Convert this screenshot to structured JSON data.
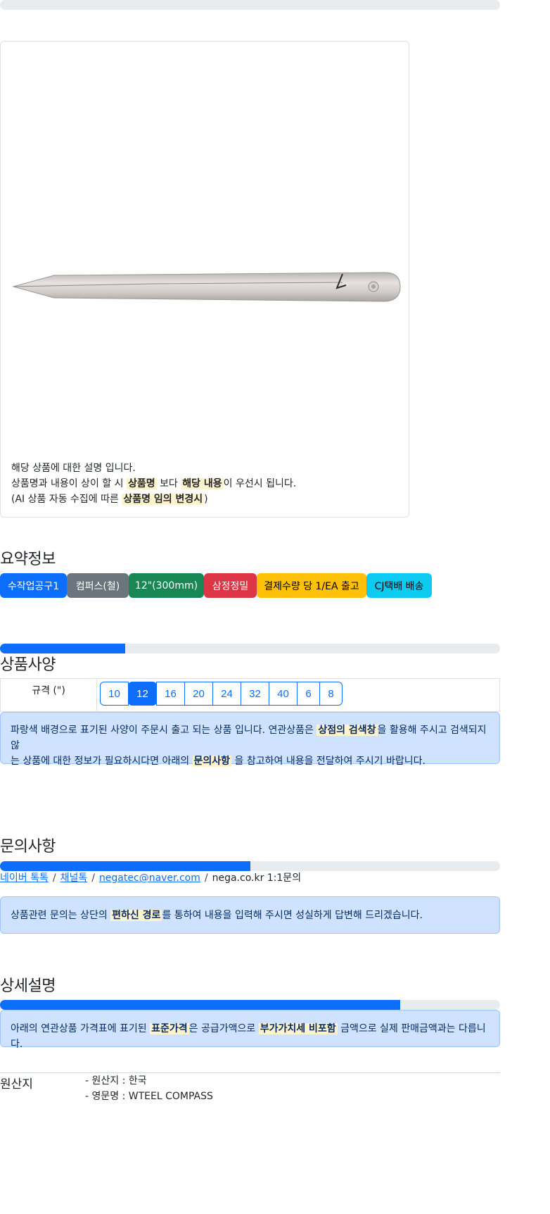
{
  "top_progress_percent": 0,
  "product": {
    "image_icon": "tweezer-product-image",
    "desc_line1": "해당 상품에 대한 설명 입니다.",
    "desc_line2_a": "상품명과 내용이 상이 할 시 ",
    "desc_line2_hl1": "상품명",
    "desc_line2_b": " 보다 ",
    "desc_line2_hl2": "해당 내용",
    "desc_line2_c": "이 우선시 됩니다.",
    "desc_line3_a": "(AI 상품 자동 수집에 따른 ",
    "desc_line3_hl": "상품명 임의 변경시",
    "desc_line3_b": ")"
  },
  "summary": {
    "title": "요약정보",
    "badges": [
      "수작업공구1",
      "컴퍼스(철)",
      "12\"(300mm)",
      "삼정정밀",
      "결제수량 당 1/EA 출고",
      "CJ택배 배송"
    ],
    "progress_percent": 25
  },
  "spec": {
    "title": "상품사양",
    "label": "규격 (\")",
    "options": [
      "10",
      "12",
      "16",
      "20",
      "24",
      "32",
      "40",
      "6",
      "8"
    ],
    "selected": "12",
    "notice_a": "파랑색 배경으로 표기된 사양이 주문시 출고 되는 상품 입니다. 연관상품은 ",
    "notice_hl1": "상점의 검색창",
    "notice_b": "을 활용해 주시고 검색되지 않",
    "notice_c": "는 상품에 대한 정보가 필요하시다면 아래의 ",
    "notice_hl2": "문의사항",
    "notice_d": " 을 참고하여 내용을 전달하여 주시기 바랍니다."
  },
  "inquiry": {
    "title": "문의사항",
    "progress_percent": 50,
    "link1": "네이버 톡톡",
    "link2": "채널톡",
    "link3": "negatec@naver.com",
    "text4": "nega.co.kr 1:1문의",
    "separator": "/",
    "notice_a": "상품관련 문의는 상단의 ",
    "notice_hl": "편하신 경로",
    "notice_b": "를 통하여 내용을 입력해 주시면 성실하게 답변해 드리겠습니다."
  },
  "detail": {
    "title": "상세설명",
    "progress_percent": 80,
    "notice_a": "아래의 연관상품 가격표에 표기된 ",
    "notice_hl1": "표준가격",
    "notice_b": "은 공급가액으로 ",
    "notice_hl2": "부가가치세 비포함",
    "notice_c": " 금액으로 실제 판매금액과는 다릅니다."
  },
  "origin": {
    "label": "원산지",
    "line1": "- 원산지 : 한국",
    "line2": "- 영문명 : WTEEL COMPASS"
  },
  "colors": {
    "primary": "#0d6efd",
    "secondary": "#6c757d",
    "success": "#198754",
    "danger": "#dc3545",
    "warning": "#ffc107",
    "info": "#0dcaf0",
    "alert_bg": "#cfe2ff",
    "highlight": "#fff3cd"
  }
}
